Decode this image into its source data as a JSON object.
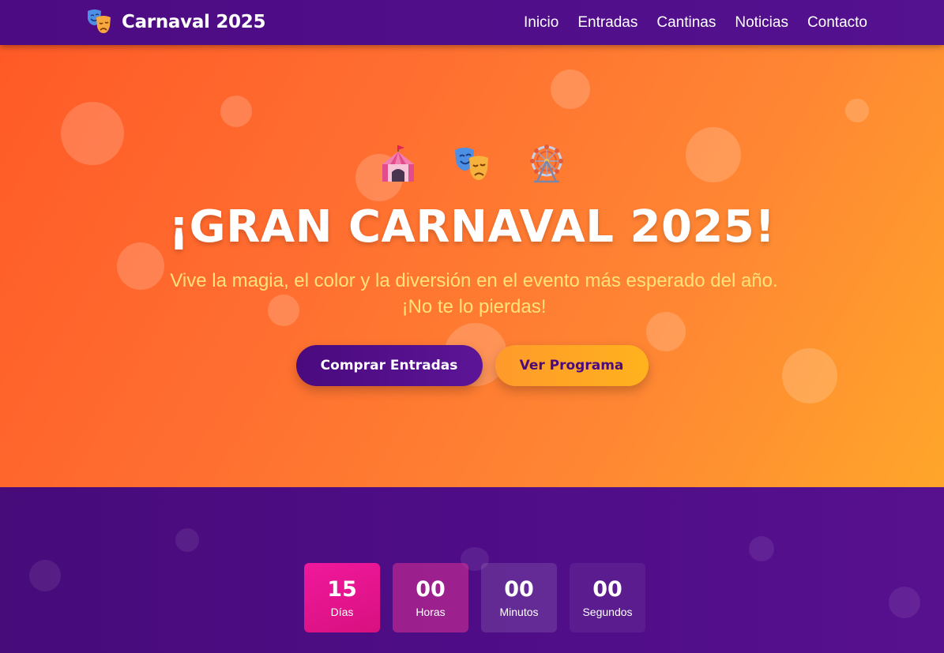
{
  "navbar": {
    "brand": "Carnaval 2025",
    "brand_icon": "theater-masks-icon",
    "links": [
      {
        "label": "Inicio"
      },
      {
        "label": "Entradas"
      },
      {
        "label": "Cantinas"
      },
      {
        "label": "Noticias"
      },
      {
        "label": "Contacto"
      }
    ]
  },
  "hero": {
    "emojis": [
      "circus-tent-icon",
      "theater-masks-icon",
      "ferris-wheel-icon"
    ],
    "title": "¡GRAN CARNAVAL 2025!",
    "subtitle": "Vive la magia, el color y la diversión en el evento más esperado del año. ¡No te lo pierdas!",
    "primary_button": "Comprar Entradas",
    "secondary_button": "Ver Programa"
  },
  "countdown": [
    {
      "value": "15",
      "label": "Días"
    },
    {
      "value": "00",
      "label": "Horas"
    },
    {
      "value": "00",
      "label": "Minutos"
    },
    {
      "value": "00",
      "label": "Segundos"
    }
  ],
  "colors": {
    "nav_bg": "#4c0b82",
    "hero_start": "#ff5a26",
    "hero_end": "#ffa62a",
    "subtitle": "#ffe27a",
    "accent_pink": "#f0189c",
    "purple": "#4a0a7e"
  }
}
